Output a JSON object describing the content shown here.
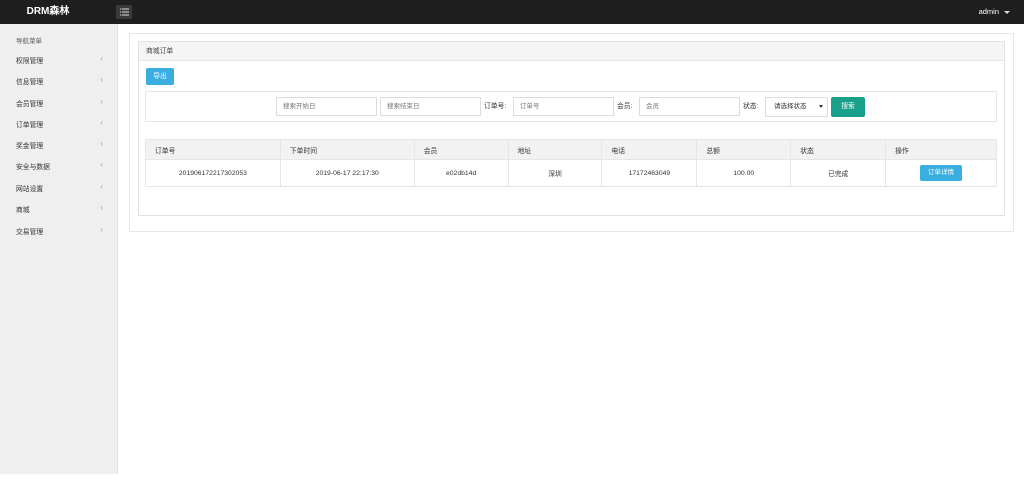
{
  "header": {
    "brand": "DRM森林",
    "user": "admin"
  },
  "sidebar": {
    "title": "导航菜单",
    "items": [
      {
        "label": "权限管理"
      },
      {
        "label": "信息管理"
      },
      {
        "label": "会员管理"
      },
      {
        "label": "订单管理"
      },
      {
        "label": "奖金管理"
      },
      {
        "label": "安全与数据"
      },
      {
        "label": "网站设置"
      },
      {
        "label": "商城"
      },
      {
        "label": "交易管理"
      }
    ]
  },
  "panel": {
    "title": "商城订单",
    "export_label": "导出"
  },
  "filters": {
    "start_date_placeholder": "搜索开始日",
    "end_date_placeholder": "搜索结束日",
    "order_no_label": "订单号:",
    "order_no_placeholder": "订单号",
    "member_label": "会员:",
    "member_placeholder": "会员",
    "status_label": "状态:",
    "status_value": "请选择状态",
    "search_label": "搜索"
  },
  "table": {
    "columns": [
      "订单号",
      "下单时间",
      "会员",
      "地址",
      "电话",
      "总额",
      "状态",
      "操作"
    ],
    "rows": [
      {
        "order_no": "201906172217302053",
        "time": "2019-06-17 22:17:30",
        "member": "e02db14d",
        "address": "深圳",
        "phone": "17172463049",
        "total": "100.00",
        "status": "已完成",
        "action": "订单详情"
      }
    ]
  },
  "colors": {
    "topbar": "#1f1f1f",
    "sidebar": "#efefef",
    "primary_button": "#3aaee0",
    "search_button": "#19a08a"
  },
  "icons": {
    "menu_toggle": "hamburger-list-icon",
    "user_menu": "caret-down-icon",
    "nav_chevron": "chevron-left-icon"
  }
}
